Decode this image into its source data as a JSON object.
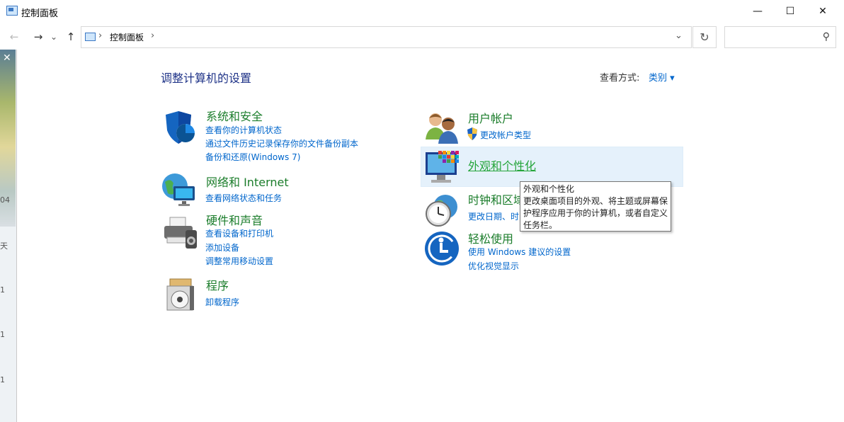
{
  "window": {
    "title": "控制面板",
    "minimize_icon": "—",
    "maximize_icon": "☐",
    "close_icon": "✕"
  },
  "nav": {
    "back": "←",
    "forward": "→",
    "recent": "⌄",
    "up": "↑",
    "breadcrumb": "控制面板",
    "breadcrumb_sep": "›",
    "dropdown": "⌄",
    "refresh": "↻",
    "search_placeholder": "",
    "search_icon": "⚲"
  },
  "background_chars": [
    "04",
    "天",
    "1",
    "1",
    "1"
  ],
  "main": {
    "heading": "调整计算机的设置",
    "view_by_label": "查看方式:",
    "view_by_value": "类别 ▾"
  },
  "categories_left": [
    {
      "title": "系统和安全",
      "icon": "shield-icon",
      "links": [
        "查看你的计算机状态",
        "通过文件历史记录保存你的文件备份副本",
        "备份和还原(Windows 7)"
      ]
    },
    {
      "title": "网络和 Internet",
      "icon": "network-globe-icon",
      "links": [
        "查看网络状态和任务"
      ]
    },
    {
      "title": "硬件和声音",
      "icon": "printer-speaker-icon",
      "links": [
        "查看设备和打印机",
        "添加设备",
        "调整常用移动设置"
      ]
    },
    {
      "title": "程序",
      "icon": "programs-disc-icon",
      "links": [
        "卸载程序"
      ]
    }
  ],
  "categories_right": [
    {
      "title": "用户帐户",
      "icon": "users-icon",
      "links": [
        "更改帐户类型"
      ]
    },
    {
      "title": "外观和个性化",
      "icon": "monitor-color-icon",
      "links": []
    },
    {
      "title": "时钟和区域",
      "icon": "clock-globe-icon",
      "links": [
        "更改日期、时间或数字格式"
      ]
    },
    {
      "title": "轻松使用",
      "icon": "ease-of-access-icon",
      "links": [
        "使用 Windows 建议的设置",
        "优化视觉显示"
      ]
    }
  ],
  "tooltip": {
    "title": "外观和个性化",
    "body": "更改桌面项目的外观、将主题或屏幕保护程序应用于你的计算机，或者自定义任务栏。"
  },
  "colors": {
    "category_title": "#1b7d2b",
    "link": "#0066cc",
    "heading": "#1e3287",
    "hover_bg": "#e5f1fb"
  }
}
